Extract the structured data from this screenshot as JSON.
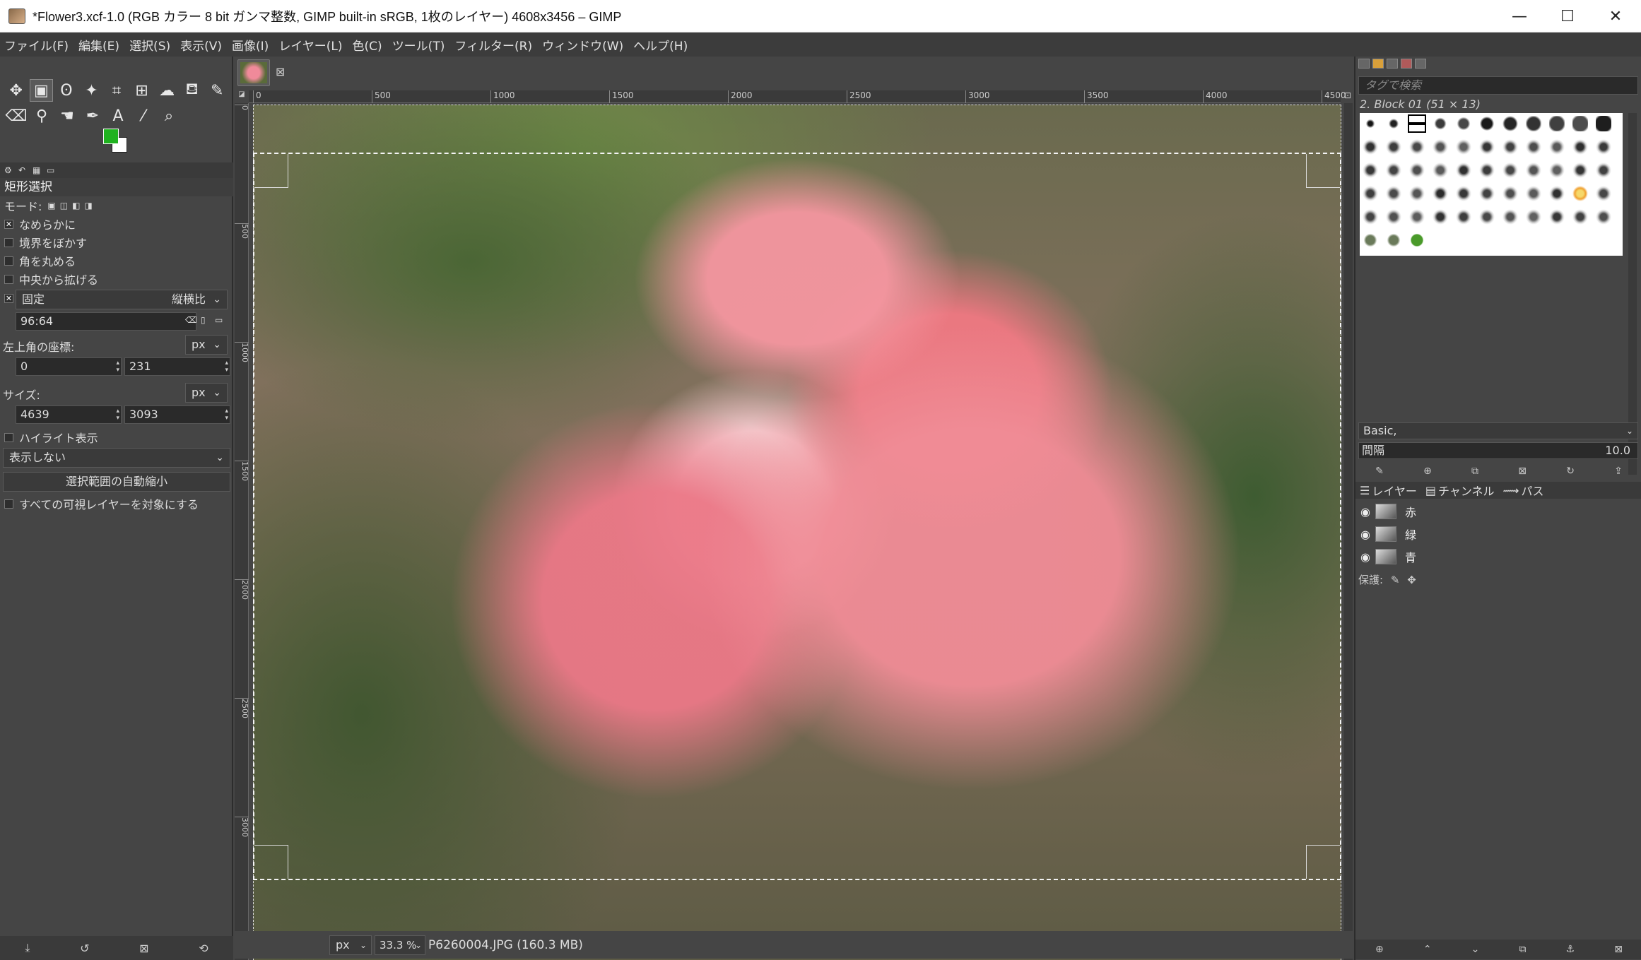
{
  "window": {
    "title": "*Flower3.xcf-1.0 (RGB カラー 8 bit ガンマ整数, GIMP built-in sRGB, 1枚のレイヤー) 4608x3456 – GIMP",
    "minimize": "—",
    "maximize": "☐",
    "close": "✕"
  },
  "menu": [
    "ファイル(F)",
    "編集(E)",
    "選択(S)",
    "表示(V)",
    "画像(I)",
    "レイヤー(L)",
    "色(C)",
    "ツール(T)",
    "フィルター(R)",
    "ウィンドウ(W)",
    "ヘルプ(H)"
  ],
  "colors": {
    "foreground": "#1fb21f",
    "background": "#ffffff"
  },
  "tool_options": {
    "title": "矩形選択",
    "mode_label": "モード:",
    "antialias": "なめらかに",
    "feather": "境界をぼかす",
    "rounded": "角を丸める",
    "expand_center": "中央から拡げる",
    "fixed_label": "固定",
    "fixed_mode": "縦横比",
    "fixed_value": "96:64",
    "position_label": "左上角の座標:",
    "position_unit": "px",
    "pos_x": "0",
    "pos_y": "231",
    "size_label": "サイズ:",
    "size_unit": "px",
    "size_w": "4639",
    "size_h": "3093",
    "highlight": "ハイライト表示",
    "guides": "表示しない",
    "auto_shrink": "選択範囲の自動縮小",
    "shrink_merged": "すべての可視レイヤーを対象にする"
  },
  "ruler": {
    "h_labels": [
      "0",
      "500",
      "1000",
      "1500",
      "2000",
      "2500",
      "3000",
      "3500",
      "4000",
      "4500"
    ],
    "v_labels": [
      "0",
      "500",
      "1000",
      "1500",
      "2000",
      "2500",
      "3000"
    ]
  },
  "status": {
    "unit": "px",
    "zoom": "33.3 %",
    "file_info": "P6260004.JPG (160.3 MB)"
  },
  "brushes": {
    "tag_search_placeholder": "タグで検索",
    "selected_brush": "2. Block 01 (51 × 13)",
    "preset": "Basic,",
    "spacing_label": "間隔",
    "spacing_value": "10.0"
  },
  "layers_panel": {
    "tabs": [
      "レイヤー",
      "チャンネル",
      "パス"
    ],
    "layers": [
      {
        "name": "赤"
      },
      {
        "name": "緑"
      },
      {
        "name": "青"
      }
    ],
    "lock_label": "保護:"
  }
}
